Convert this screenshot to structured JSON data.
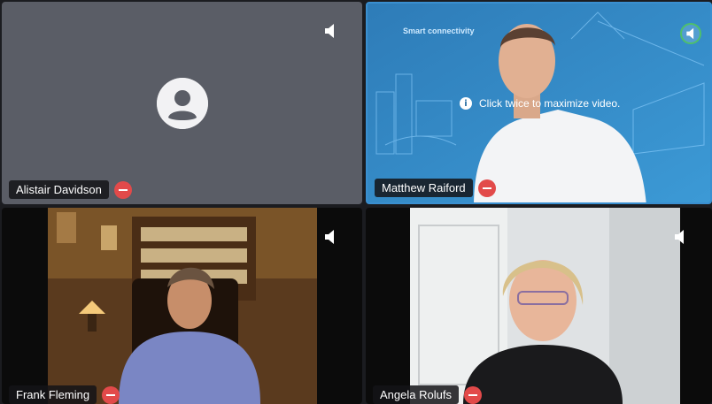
{
  "participants": [
    {
      "name": "Alistair Davidson",
      "muted": true,
      "video": false,
      "avatar_icon": "person-icon",
      "speaker_icon": "speaker-icon"
    },
    {
      "name": "Matthew Raiford",
      "muted": true,
      "video": true,
      "speaker_icon": "speaker-icon",
      "active_speaker": true,
      "background_text": "Smart connectivity"
    },
    {
      "name": "Frank Fleming",
      "muted": true,
      "video": true,
      "speaker_icon": "speaker-icon"
    },
    {
      "name": "Angela Rolufs",
      "muted": true,
      "video": true,
      "speaker_icon": "speaker-icon"
    }
  ],
  "tooltip": {
    "icon": "info-icon",
    "text": "Click twice to maximize video."
  },
  "colors": {
    "mute_badge": "#e24a4a",
    "active_ring": "#4ec06a",
    "tile_bg": "#5a5d66"
  }
}
